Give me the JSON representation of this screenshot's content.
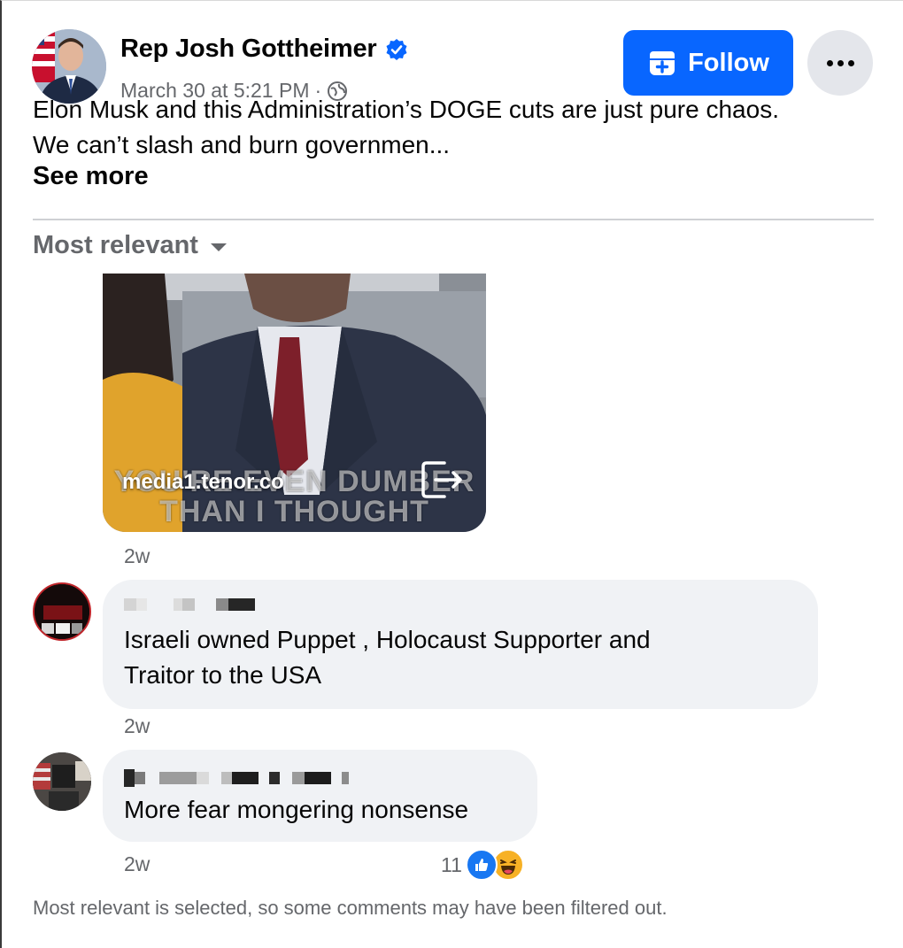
{
  "post": {
    "author": "Rep Josh Gottheimer",
    "timestamp": "March 30 at 5:21 PM",
    "meta_separator": "·",
    "text": "Elon Musk and this Administration’s DOGE cuts are just pure chaos. We can’t slash and burn governmen...",
    "see_more": "See more",
    "follow_label": "Follow"
  },
  "sort": {
    "label": "Most relevant"
  },
  "gif": {
    "domain": "media1.tenor.co",
    "caption_line1": "YOU'RE EVEN DUMBER",
    "caption_line2": "THAN I THOUGHT",
    "time": "2w"
  },
  "comments": [
    {
      "text_line1": "Israeli owned Puppet , Holocaust Supporter and",
      "text_line2": "Traitor to the USA",
      "time": "2w"
    },
    {
      "text": "More fear mongering nonsense",
      "time": "2w",
      "reaction_count": "11"
    }
  ],
  "footer": {
    "note": "Most relevant is selected, so some comments may have been filtered out."
  },
  "colors": {
    "accent": "#0866ff",
    "secondary_text": "#65676b",
    "bubble": "#f0f2f5"
  }
}
